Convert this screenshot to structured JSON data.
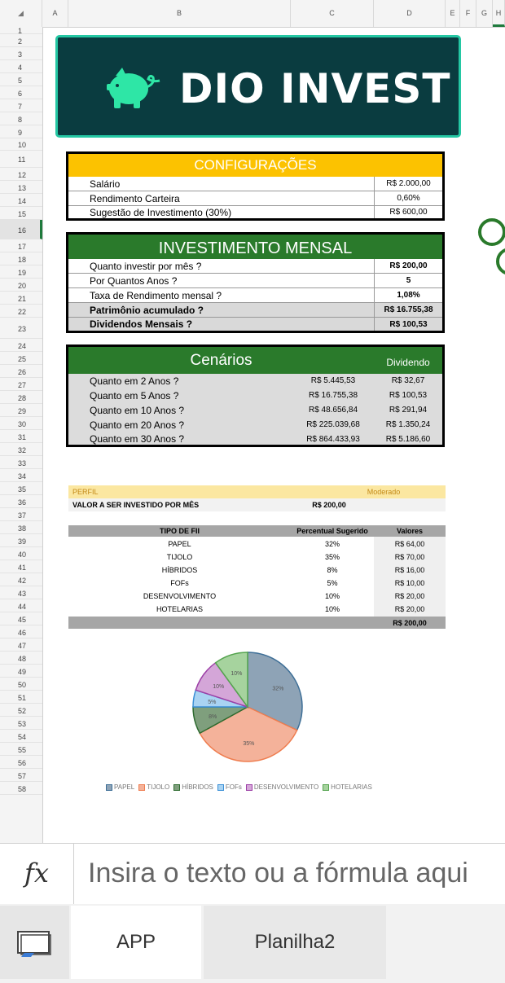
{
  "columns": [
    "A",
    "B",
    "C",
    "D",
    "E",
    "F",
    "G",
    "H"
  ],
  "rows": [
    "1",
    "2",
    "3",
    "4",
    "5",
    "6",
    "7",
    "8",
    "9",
    "10",
    "11",
    "12",
    "13",
    "14",
    "15",
    "16",
    "17",
    "18",
    "19",
    "20",
    "21",
    "22",
    "23",
    "24",
    "25",
    "26",
    "27",
    "28",
    "29",
    "30",
    "31",
    "32",
    "33",
    "34",
    "35",
    "36",
    "37",
    "38",
    "39",
    "40",
    "41",
    "42",
    "43",
    "44",
    "45",
    "46",
    "47",
    "48",
    "49",
    "50",
    "51",
    "52",
    "53",
    "54",
    "55",
    "56",
    "57",
    "58"
  ],
  "banner": {
    "title": "DIO INVEST"
  },
  "config": {
    "title": "CONFIGURAÇÕES",
    "rows": [
      {
        "label": "Salário",
        "value": "R$ 2.000,00"
      },
      {
        "label": "Rendimento Carteira",
        "value": "0,60%"
      },
      {
        "label": "Sugestão de Investimento (30%)",
        "value": "R$ 600,00"
      }
    ]
  },
  "mensal": {
    "title": "INVESTIMENTO MENSAL",
    "rows": [
      {
        "label": "Quanto investir por mês ?",
        "value": "R$ 200,00"
      },
      {
        "label": "Por Quantos Anos ?",
        "value": "5"
      },
      {
        "label": "Taxa de Rendimento mensal ?",
        "value": "1,08%"
      },
      {
        "label": "Patrimônio acumulado ?",
        "value": "R$ 16.755,38"
      },
      {
        "label": "Dividendos Mensais ?",
        "value": "R$ 100,53"
      }
    ]
  },
  "cenarios": {
    "title": "Cenários",
    "dividendo_label": "Dividendo",
    "rows": [
      {
        "label": "Quanto em 2 Anos ?",
        "total": "R$ 5.445,53",
        "dividendo": "R$ 32,67"
      },
      {
        "label": "Quanto em 5 Anos ?",
        "total": "R$ 16.755,38",
        "dividendo": "R$ 100,53"
      },
      {
        "label": "Quanto em 10 Anos ?",
        "total": "R$ 48.656,84",
        "dividendo": "R$ 291,94"
      },
      {
        "label": "Quanto em 20 Anos ?",
        "total": "R$ 225.039,68",
        "dividendo": "R$ 1.350,24"
      },
      {
        "label": "Quanto em 30 Anos ?",
        "total": "R$ 864.433,93",
        "dividendo": "R$ 5.186,60"
      }
    ]
  },
  "perfil": {
    "label": "PERFIL",
    "value": "Moderado",
    "valor_label": "VALOR A SER INVESTIDO POR MÊS",
    "valor": "R$ 200,00"
  },
  "fii": {
    "headers": [
      "TIPO DE FII",
      "Percentual Sugerido",
      "Valores"
    ],
    "rows": [
      {
        "tipo": "PAPEL",
        "pct": "32%",
        "valor": "R$ 64,00"
      },
      {
        "tipo": "TIJOLO",
        "pct": "35%",
        "valor": "R$ 70,00"
      },
      {
        "tipo": "HÍBRIDOS",
        "pct": "8%",
        "valor": "R$ 16,00"
      },
      {
        "tipo": "FOFs",
        "pct": "5%",
        "valor": "R$ 10,00"
      },
      {
        "tipo": "DESENVOLVIMENTO",
        "pct": "10%",
        "valor": "R$ 20,00"
      },
      {
        "tipo": "HOTELARIAS",
        "pct": "10%",
        "valor": "R$ 20,00"
      }
    ],
    "total": "R$ 200,00"
  },
  "chart_data": {
    "type": "pie",
    "categories": [
      "PAPEL",
      "TIJOLO",
      "HÍBRIDOS",
      "FOFs",
      "DESENVOLVIMENTO",
      "HOTELARIAS"
    ],
    "values": [
      32,
      35,
      8,
      5,
      10,
      10
    ],
    "data_labels": [
      "32%",
      "35%",
      "8%",
      "5%",
      "10%",
      "10%"
    ],
    "colors": [
      "#8ea3b6",
      "#f4b29a",
      "#7f9f7d",
      "#a9d3f2",
      "#d4a6d8",
      "#a6d39e"
    ],
    "stroke_colors": [
      "#3e6f97",
      "#ef7d4f",
      "#2e6b30",
      "#3a8fd6",
      "#9c3fa6",
      "#55a44f"
    ],
    "legend": "bottom"
  },
  "formula_bar": {
    "fx": "fx",
    "placeholder": "Insira o texto ou a fórmula aqui"
  },
  "sheet_tabs": [
    "APP",
    "Planilha2"
  ],
  "colors": {
    "banner": "#0a3c40",
    "config_header": "#fcc200",
    "green_header": "#2a7a2b",
    "perfil_bg": "#fbe7a1"
  }
}
